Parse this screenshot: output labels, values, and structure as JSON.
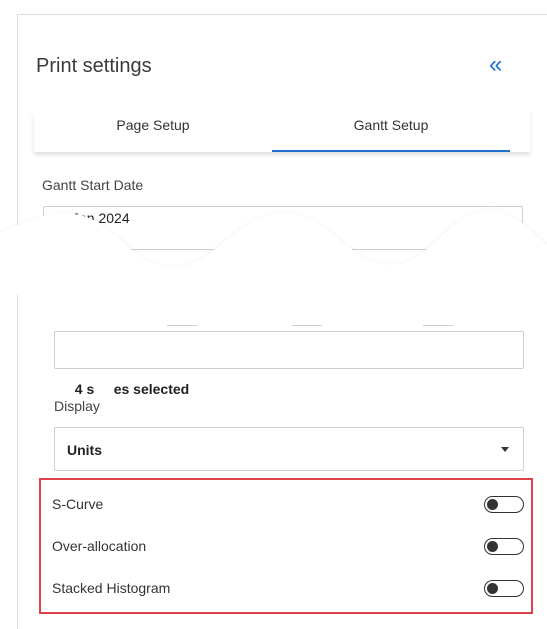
{
  "header": {
    "title": "Print settings",
    "collapse_glyph": "«"
  },
  "tabs": [
    {
      "label": "Page Setup",
      "active": false
    },
    {
      "label": "Gantt Setup",
      "active": true
    }
  ],
  "gantt_start": {
    "label": "Gantt Start Date",
    "value": "Jan 2024"
  },
  "selection": {
    "value": "4 s     es selected"
  },
  "display": {
    "label": "Display",
    "value": "Units"
  },
  "toggles": [
    {
      "label": "S-Curve",
      "on": false
    },
    {
      "label": "Over-allocation",
      "on": false
    },
    {
      "label": "Stacked Histogram",
      "on": false
    }
  ],
  "colors": {
    "accent": "#1f6fd1",
    "highlight": "#e0424a"
  }
}
